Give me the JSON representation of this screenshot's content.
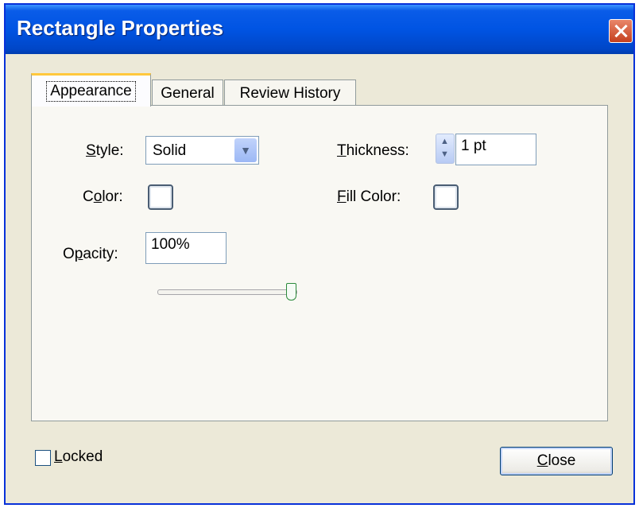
{
  "dialog": {
    "title": "Rectangle Properties"
  },
  "tabs": [
    {
      "label": "Appearance",
      "active": true
    },
    {
      "label": "General",
      "active": false
    },
    {
      "label": "Review History",
      "active": false
    }
  ],
  "appearance": {
    "style_label_ul": "S",
    "style_label_rest": "tyle:",
    "style_value": "Solid",
    "color_label_pre": "C",
    "color_label_ul": "o",
    "color_label_rest": "lor:",
    "opacity_label_pre": "O",
    "opacity_label_ul": "p",
    "opacity_label_rest": "acity:",
    "opacity_value": "100%",
    "opacity_slider_fraction": 1.0,
    "thickness_label_ul": "T",
    "thickness_label_rest": "hickness:",
    "thickness_value": "1 pt",
    "fill_label_ul": "F",
    "fill_label_rest": "ill Color:",
    "stroke_color": "#ffffff",
    "fill_color": "#ffffff"
  },
  "footer": {
    "locked_ul": "L",
    "locked_rest": "ocked",
    "locked_checked": false,
    "close_ul": "C",
    "close_rest": "lose"
  },
  "icons": {
    "close": "close-icon",
    "dropdown": "chevron-down-icon",
    "spin_up": "spin-up-icon",
    "spin_down": "spin-down-icon"
  }
}
